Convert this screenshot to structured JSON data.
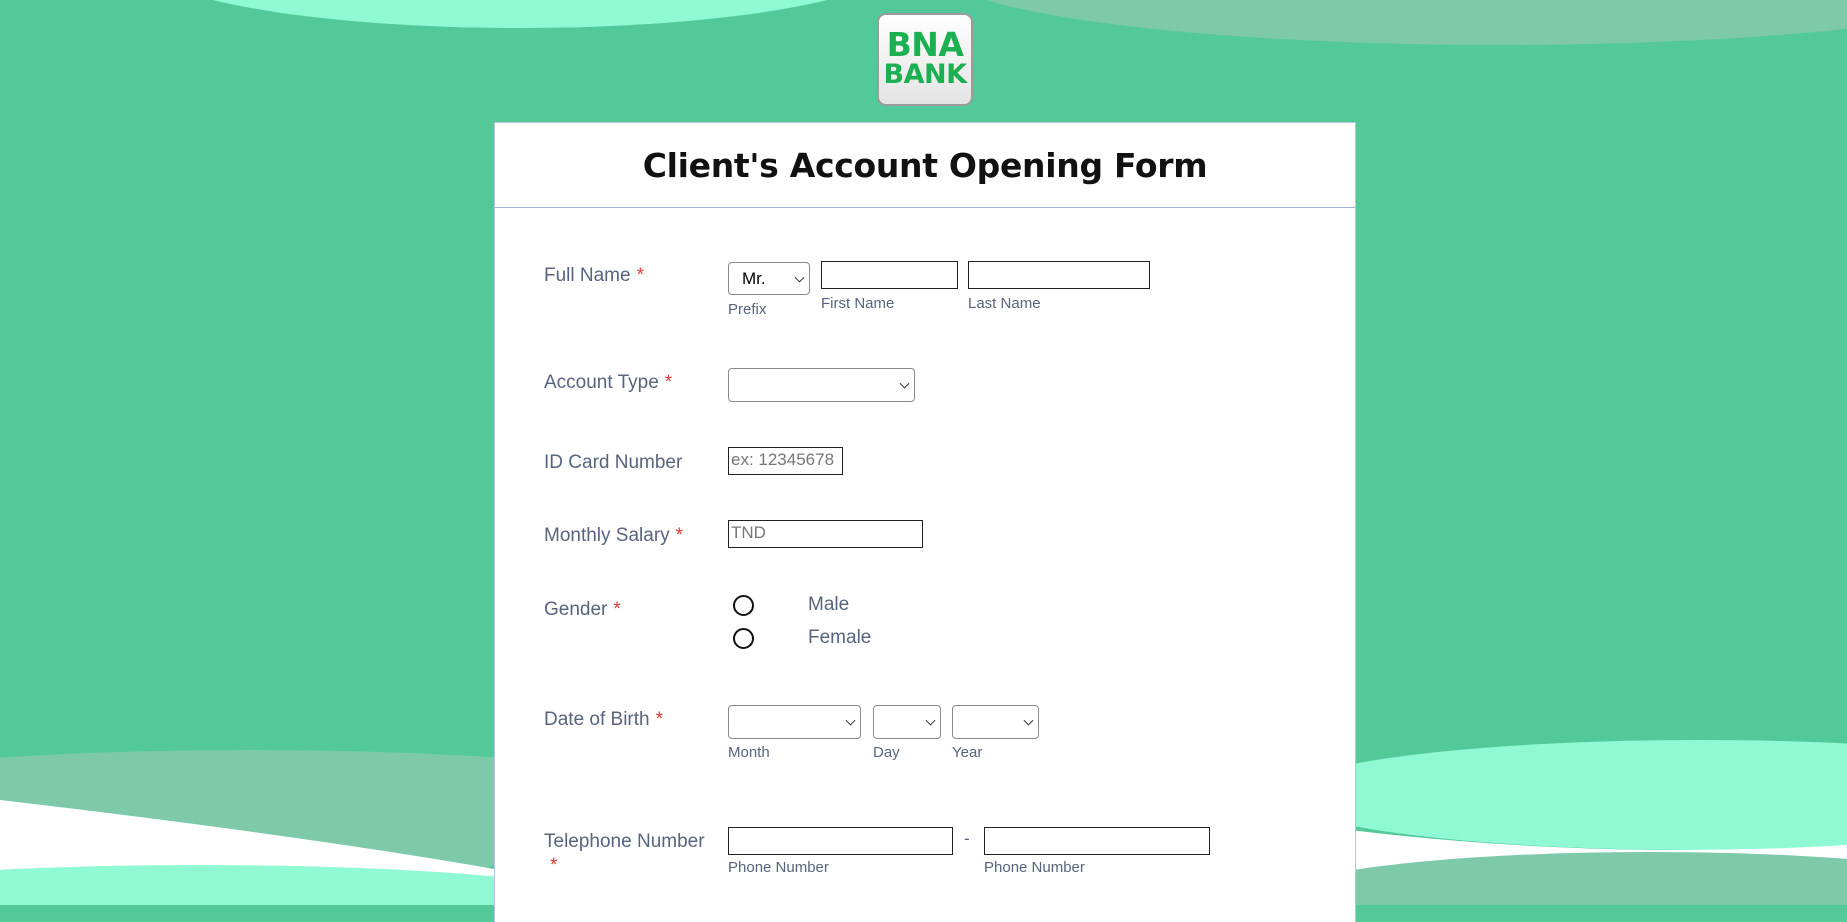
{
  "logo": {
    "line1": "BNA",
    "line2": "BANK"
  },
  "form": {
    "title": "Client's Account Opening Form",
    "full_name": {
      "label": "Full Name",
      "required": "*",
      "prefix_value": "Mr.",
      "prefix_sublabel": "Prefix",
      "first_name_value": "",
      "first_name_sublabel": "First Name",
      "last_name_value": "",
      "last_name_sublabel": "Last Name"
    },
    "account_type": {
      "label": "Account Type",
      "required": "*",
      "value": ""
    },
    "id_card": {
      "label": "ID Card Number",
      "placeholder": "ex: 12345678"
    },
    "monthly_salary": {
      "label": "Monthly Salary",
      "required": "*",
      "placeholder": "TND"
    },
    "gender": {
      "label": "Gender",
      "required": "*",
      "options": [
        "Male",
        "Female"
      ]
    },
    "dob": {
      "label": "Date of Birth",
      "required": "*",
      "month_sublabel": "Month",
      "day_sublabel": "Day",
      "year_sublabel": "Year"
    },
    "telephone": {
      "label": "Telephone Number",
      "required": "*",
      "separator": "-",
      "sublabel1": "Phone Number",
      "sublabel2": "Phone Number"
    }
  },
  "colors": {
    "background": "#53c99a",
    "wave_light": "#8ff9d3",
    "wave_dark": "#7dc9aa",
    "logo_green": "#1db052",
    "required_red": "#e53935"
  }
}
